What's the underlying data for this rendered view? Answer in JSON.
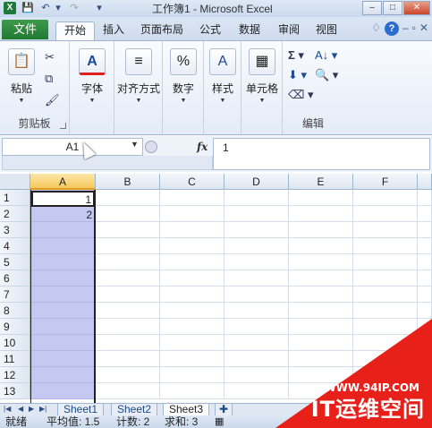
{
  "window": {
    "title": "工作簿1 - Microsoft Excel",
    "app_icon": "X",
    "quick_access": [
      "save-icon",
      "undo-icon",
      "redo-icon",
      "customize-icon"
    ],
    "buttons": {
      "minimize": "–",
      "maximize": "□",
      "close": "✕"
    }
  },
  "ribbon_tabs": {
    "file": "文件",
    "tabs": [
      "开始",
      "插入",
      "页面布局",
      "公式",
      "数据",
      "审阅",
      "视图"
    ],
    "active": "开始"
  },
  "ribbon": {
    "clipboard": {
      "paste": "粘贴",
      "group": "剪贴板"
    },
    "font": {
      "label": "字体"
    },
    "align": {
      "label": "对齐方式"
    },
    "number": {
      "label": "数字"
    },
    "styles": {
      "label": "样式"
    },
    "cells": {
      "label": "单元格"
    },
    "editing": {
      "group": "编辑"
    }
  },
  "formula_bar": {
    "name_box": "A1",
    "fx": "fx",
    "value": "1"
  },
  "grid": {
    "columns": [
      "A",
      "B",
      "C",
      "D",
      "E",
      "F"
    ],
    "rows": [
      "1",
      "2",
      "3",
      "4",
      "5",
      "6",
      "7",
      "8",
      "9",
      "10",
      "11",
      "12",
      "13"
    ],
    "cells": {
      "A1": "1",
      "A2": "2"
    }
  },
  "sheets": {
    "tabs": [
      "Sheet1",
      "Sheet2",
      "Sheet3"
    ],
    "active": "Sheet3"
  },
  "status": {
    "mode": "就绪",
    "average": "平均值: 1.5",
    "count": "计数: 2",
    "sum": "求和: 3"
  },
  "watermark": {
    "url": "WWW.94IP.COM",
    "title": "IT运维空间"
  },
  "colors": {
    "selection": "#c5c9f2",
    "header_selected": "#f6c85d",
    "file_tab": "#2a8a3d",
    "watermark": "#e8201a"
  }
}
